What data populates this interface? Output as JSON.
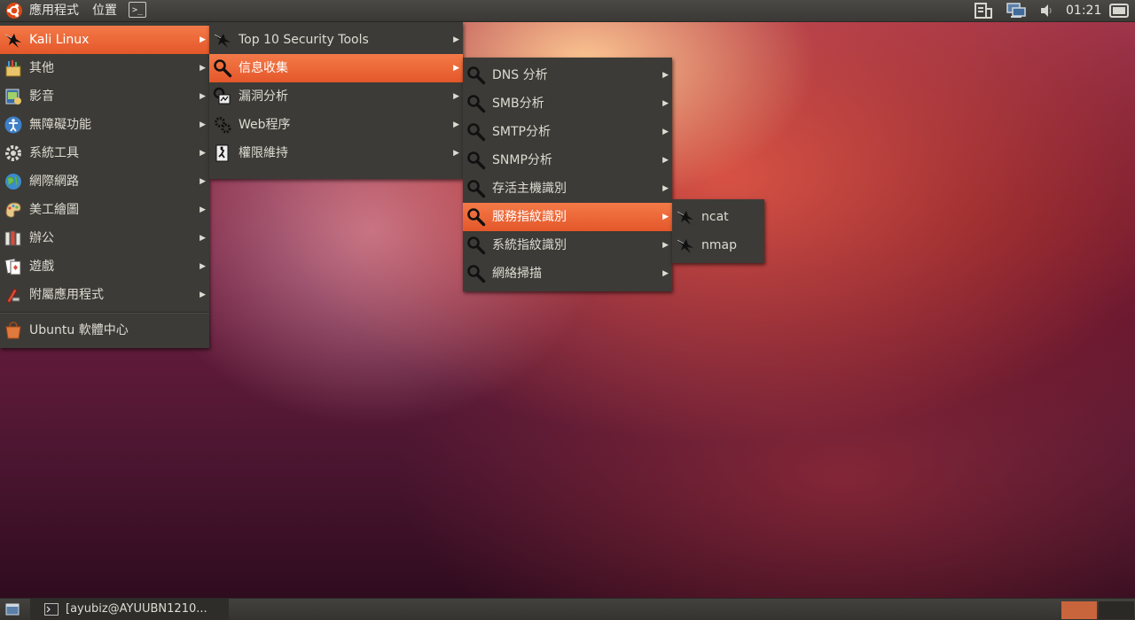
{
  "top_panel": {
    "applications": "應用程式",
    "places": "位置",
    "terminal_glyph": ">_",
    "clock": "01:21"
  },
  "menu_main": {
    "items": [
      {
        "label": "Kali Linux",
        "icon": "kali-dragon-icon",
        "active": true
      },
      {
        "label": "其他",
        "icon": "other-apps-icon"
      },
      {
        "label": "影音",
        "icon": "sound-video-icon"
      },
      {
        "label": "無障礙功能",
        "icon": "accessibility-icon"
      },
      {
        "label": "系統工具",
        "icon": "system-tools-icon"
      },
      {
        "label": "網際網路",
        "icon": "internet-globe-icon"
      },
      {
        "label": "美工繪圖",
        "icon": "graphics-icon"
      },
      {
        "label": "辦公",
        "icon": "office-icon"
      },
      {
        "label": "遊戲",
        "icon": "games-icon"
      },
      {
        "label": "附屬應用程式",
        "icon": "accessories-icon"
      }
    ],
    "footer_item": {
      "label": "Ubuntu 軟體中心",
      "icon": "software-center-icon"
    }
  },
  "menu_kali": {
    "items": [
      {
        "label": "Top 10 Security Tools",
        "icon": "kali-dragon-icon"
      },
      {
        "label": "信息收集",
        "icon": "magnifier-icon",
        "active": true
      },
      {
        "label": "漏洞分析",
        "icon": "vulnerability-icon"
      },
      {
        "label": "Web程序",
        "icon": "gears-icon"
      },
      {
        "label": "權限維持",
        "icon": "exit-door-icon"
      }
    ]
  },
  "menu_info": {
    "items": [
      {
        "label": "DNS 分析",
        "icon": "magnifier-icon"
      },
      {
        "label": "SMB分析",
        "icon": "magnifier-icon"
      },
      {
        "label": "SMTP分析",
        "icon": "magnifier-icon"
      },
      {
        "label": "SNMP分析",
        "icon": "magnifier-icon"
      },
      {
        "label": "存活主機識別",
        "icon": "magnifier-icon"
      },
      {
        "label": "服務指紋識別",
        "icon": "magnifier-icon",
        "active": true
      },
      {
        "label": "系統指紋識別",
        "icon": "magnifier-icon"
      },
      {
        "label": "網絡掃描",
        "icon": "magnifier-icon"
      }
    ]
  },
  "menu_fingerprint": {
    "items": [
      {
        "label": "ncat",
        "icon": "kali-dragon-icon"
      },
      {
        "label": "nmap",
        "icon": "kali-dragon-icon"
      }
    ]
  },
  "bottom_panel": {
    "task_label": "[ayubiz@AYUUBN1210..."
  },
  "colors": {
    "panel": "#3c3b37",
    "highlight": "#f0683a",
    "text": "#dfdbd2"
  }
}
